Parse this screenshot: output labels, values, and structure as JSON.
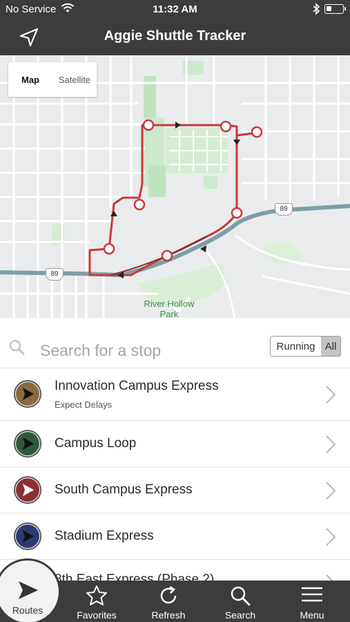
{
  "status_bar": {
    "carrier": "No Service",
    "time": "11:32 AM",
    "battery_level": 0.3
  },
  "header": {
    "title": "Aggie Shuttle Tracker",
    "locate_icon": "location-arrow-icon"
  },
  "map": {
    "toggle": {
      "map_label": "Map",
      "satellite_label": "Satellite",
      "selected": "Map"
    },
    "park_label": "River Hollow Park",
    "highway_label": "89",
    "route_color": "#c8383a"
  },
  "search": {
    "placeholder": "Search for a stop",
    "value": "",
    "filter": {
      "running_label": "Running",
      "all_label": "All",
      "selected": "All"
    }
  },
  "routes": [
    {
      "name": "Innovation Campus Express",
      "note": "Expect Delays",
      "color": "#8b6a3e"
    },
    {
      "name": "Campus Loop",
      "note": "",
      "color": "#2f5a3a"
    },
    {
      "name": "South Campus Express",
      "note": "",
      "color": "#8a2f34"
    },
    {
      "name": "Stadium Express",
      "note": "",
      "color": "#2f3a74"
    },
    {
      "name": "8th East Express (Phase 2)",
      "note": "",
      "color": "#555555"
    }
  ],
  "tabbar": {
    "routes_label": "Routes",
    "favorites_label": "Favorites",
    "refresh_label": "Refresh",
    "search_label": "Search",
    "menu_label": "Menu"
  }
}
